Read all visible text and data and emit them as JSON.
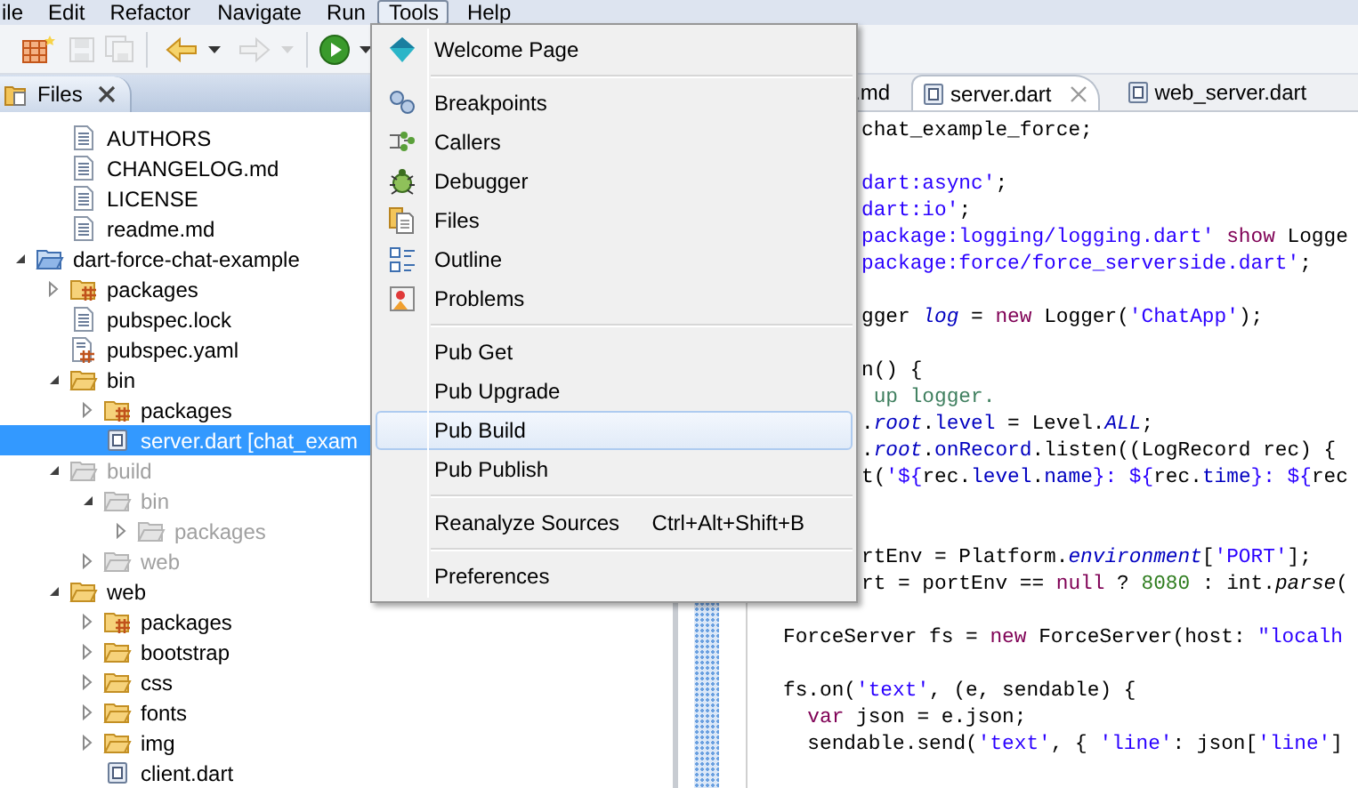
{
  "menu_bar": [
    {
      "label": "ile",
      "selected": false
    },
    {
      "label": "Edit",
      "selected": false
    },
    {
      "label": "Refactor",
      "selected": false
    },
    {
      "label": "Navigate",
      "selected": false
    },
    {
      "label": "Run",
      "selected": false
    },
    {
      "label": "Tools",
      "selected": true
    },
    {
      "label": "Help",
      "selected": false
    }
  ],
  "toolbar": [
    {
      "kind": "new",
      "disabled": false
    },
    {
      "kind": "save",
      "disabled": true
    },
    {
      "kind": "save_all",
      "disabled": true
    },
    {
      "kind": "separator"
    },
    {
      "kind": "back",
      "disabled": false
    },
    {
      "kind": "dropdown",
      "disabled": false
    },
    {
      "kind": "forward",
      "disabled": true
    },
    {
      "kind": "dropdown",
      "disabled": true
    },
    {
      "kind": "separator"
    },
    {
      "kind": "run",
      "disabled": false
    },
    {
      "kind": "dropdown",
      "disabled": false
    }
  ],
  "files_view": {
    "tab": {
      "label": "Files",
      "selected": true
    },
    "tree": {
      "continued_children": [
        {
          "label": "AUTHORS",
          "kind": "file",
          "selected": false,
          "greyed": false
        },
        {
          "label": "CHANGELOG.md",
          "kind": "file",
          "selected": false,
          "greyed": false
        },
        {
          "label": "LICENSE",
          "kind": "file",
          "selected": false,
          "greyed": false
        },
        {
          "label": "readme.md",
          "kind": "file",
          "selected": false,
          "greyed": false
        }
      ],
      "items": [
        {
          "label": "dart-force-chat-example",
          "kind": "project",
          "expanded": true,
          "selected": false,
          "greyed": false,
          "children": [
            {
              "label": "packages",
              "kind": "package_folder",
              "expanded": false,
              "selected": false,
              "greyed": false
            },
            {
              "label": "pubspec.lock",
              "kind": "file",
              "selected": false,
              "greyed": false
            },
            {
              "label": "pubspec.yaml",
              "kind": "yaml_file",
              "selected": false,
              "greyed": false
            },
            {
              "label": "bin",
              "kind": "folder",
              "expanded": true,
              "selected": false,
              "greyed": false,
              "children": [
                {
                  "label": "packages",
                  "kind": "package_folder",
                  "expanded": false,
                  "selected": false,
                  "greyed": false
                },
                {
                  "label": "server.dart [chat_exam",
                  "kind": "dart_file",
                  "selected": true,
                  "greyed": false
                }
              ]
            },
            {
              "label": "build",
              "kind": "folder",
              "expanded": true,
              "selected": false,
              "greyed": true,
              "children": [
                {
                  "label": "bin",
                  "kind": "folder",
                  "expanded": true,
                  "selected": false,
                  "greyed": true,
                  "children": [
                    {
                      "label": "packages",
                      "kind": "folder",
                      "expanded": false,
                      "selected": false,
                      "greyed": true
                    }
                  ]
                },
                {
                  "label": "web",
                  "kind": "folder",
                  "expanded": false,
                  "selected": false,
                  "greyed": true
                }
              ]
            },
            {
              "label": "web",
              "kind": "folder",
              "expanded": true,
              "selected": false,
              "greyed": false,
              "children": [
                {
                  "label": "packages",
                  "kind": "package_folder",
                  "expanded": false,
                  "selected": false,
                  "greyed": false
                },
                {
                  "label": "bootstrap",
                  "kind": "folder",
                  "expanded": false,
                  "selected": false,
                  "greyed": false
                },
                {
                  "label": "css",
                  "kind": "folder",
                  "expanded": false,
                  "selected": false,
                  "greyed": false
                },
                {
                  "label": "fonts",
                  "kind": "folder",
                  "expanded": false,
                  "selected": false,
                  "greyed": false
                },
                {
                  "label": "img",
                  "kind": "folder",
                  "expanded": false,
                  "selected": false,
                  "greyed": false
                },
                {
                  "label": "client.dart",
                  "kind": "dart_file",
                  "selected": false,
                  "greyed": false
                }
              ]
            }
          ]
        }
      ]
    }
  },
  "editor": {
    "tabs": [
      {
        "label": ".md",
        "selected": false
      },
      {
        "label": "server.dart",
        "selected": true
      },
      {
        "label": "web_server.dart",
        "selected": false
      }
    ],
    "lines": [
      {
        "kind": "behind_menu",
        "tokens": [
          {
            "text": "chat_example_force;",
            "kind": "plain"
          }
        ]
      },
      {
        "kind": "blank"
      },
      {
        "kind": "behind_menu",
        "tokens": [
          {
            "text": "dart:async'",
            "kind": "string"
          },
          {
            "text": ";",
            "kind": "plain"
          }
        ]
      },
      {
        "kind": "behind_menu",
        "tokens": [
          {
            "text": "dart:io'",
            "kind": "string"
          },
          {
            "text": ";",
            "kind": "plain"
          }
        ]
      },
      {
        "kind": "behind_menu",
        "tokens": [
          {
            "text": "package:logging/logging.dart'",
            "kind": "string"
          },
          {
            "text": " show",
            "kind": "keyword"
          },
          {
            "text": " Logge",
            "kind": "plain"
          }
        ]
      },
      {
        "kind": "behind_menu",
        "tokens": [
          {
            "text": "package:force/force_serverside.dart'",
            "kind": "string"
          },
          {
            "text": ";",
            "kind": "plain"
          }
        ]
      },
      {
        "kind": "blank"
      },
      {
        "kind": "behind_menu",
        "tokens": [
          {
            "text": "gger ",
            "kind": "plain"
          },
          {
            "text": "log",
            "kind": "static_field"
          },
          {
            "text": " = ",
            "kind": "plain"
          },
          {
            "text": "new",
            "kind": "keyword"
          },
          {
            "text": " Logger(",
            "kind": "plain"
          },
          {
            "text": "'ChatApp'",
            "kind": "string"
          },
          {
            "text": ");",
            "kind": "plain"
          }
        ]
      },
      {
        "kind": "blank"
      },
      {
        "kind": "behind_menu",
        "tokens": [
          {
            "text": "n() {",
            "kind": "plain"
          }
        ]
      },
      {
        "kind": "behind_menu",
        "tokens": [
          {
            "text": " up logger.",
            "kind": "comment"
          }
        ]
      },
      {
        "kind": "behind_menu",
        "tokens": [
          {
            "text": ".",
            "kind": "plain"
          },
          {
            "text": "root",
            "kind": "static_field"
          },
          {
            "text": ".",
            "kind": "plain"
          },
          {
            "text": "level",
            "kind": "field"
          },
          {
            "text": " = Level.",
            "kind": "plain"
          },
          {
            "text": "ALL",
            "kind": "static_field"
          },
          {
            "text": ";",
            "kind": "plain"
          }
        ]
      },
      {
        "kind": "behind_menu",
        "tokens": [
          {
            "text": ".",
            "kind": "plain"
          },
          {
            "text": "root",
            "kind": "static_field"
          },
          {
            "text": ".",
            "kind": "plain"
          },
          {
            "text": "onRecord",
            "kind": "field"
          },
          {
            "text": ".listen((LogRecord rec) {",
            "kind": "plain"
          }
        ]
      },
      {
        "kind": "behind_menu",
        "tokens": [
          {
            "text": "t(",
            "kind": "plain"
          },
          {
            "text": "'${",
            "kind": "string"
          },
          {
            "text": "rec.",
            "kind": "plain"
          },
          {
            "text": "level",
            "kind": "field"
          },
          {
            "text": ".",
            "kind": "plain"
          },
          {
            "text": "name",
            "kind": "field"
          },
          {
            "text": "}: ${",
            "kind": "string"
          },
          {
            "text": "rec.",
            "kind": "plain"
          },
          {
            "text": "time",
            "kind": "field"
          },
          {
            "text": "}: ${",
            "kind": "string"
          },
          {
            "text": "rec",
            "kind": "plain"
          }
        ]
      },
      {
        "kind": "blank"
      },
      {
        "kind": "blank"
      },
      {
        "kind": "behind_menu",
        "tokens": [
          {
            "text": "rtEnv = Platform.",
            "kind": "plain"
          },
          {
            "text": "environment",
            "kind": "static_field"
          },
          {
            "text": "[",
            "kind": "plain"
          },
          {
            "text": "'PORT'",
            "kind": "string"
          },
          {
            "text": "];",
            "kind": "plain"
          }
        ]
      },
      {
        "kind": "behind_menu",
        "tokens": [
          {
            "text": "rt = portEnv == ",
            "kind": "plain"
          },
          {
            "text": "null",
            "kind": "keyword"
          },
          {
            "text": " ? ",
            "kind": "plain"
          },
          {
            "text": "8080",
            "kind": "number"
          },
          {
            "text": " : int.",
            "kind": "plain"
          },
          {
            "text": "parse",
            "kind": "static_method"
          },
          {
            "text": "(",
            "kind": "plain"
          }
        ]
      },
      {
        "kind": "blank"
      },
      {
        "kind": "full",
        "tokens": [
          {
            "text": "ForceServer fs = ",
            "kind": "plain"
          },
          {
            "text": "new",
            "kind": "keyword"
          },
          {
            "text": " ForceServer(host: ",
            "kind": "plain"
          },
          {
            "text": "\"localh",
            "kind": "string"
          }
        ]
      },
      {
        "kind": "blank"
      },
      {
        "kind": "full",
        "tokens": [
          {
            "text": "fs.on(",
            "kind": "plain"
          },
          {
            "text": "'text'",
            "kind": "string"
          },
          {
            "text": ", (e, sendable) {",
            "kind": "plain"
          }
        ]
      },
      {
        "kind": "full",
        "tokens": [
          {
            "text": "  var",
            "kind": "keyword"
          },
          {
            "text": " json = e.json;",
            "kind": "plain"
          }
        ]
      },
      {
        "kind": "full",
        "tokens": [
          {
            "text": "  sendable.send(",
            "kind": "plain"
          },
          {
            "text": "'text'",
            "kind": "string"
          },
          {
            "text": ", { ",
            "kind": "plain"
          },
          {
            "text": "'line'",
            "kind": "string"
          },
          {
            "text": ": json[",
            "kind": "plain"
          },
          {
            "text": "'line'",
            "kind": "string"
          },
          {
            "text": "]",
            "kind": "plain"
          }
        ]
      }
    ]
  },
  "tools_menu": {
    "groups": [
      [
        {
          "label": "Welcome Page",
          "selected": false
        }
      ],
      [
        {
          "label": "Breakpoints",
          "selected": false
        },
        {
          "label": "Callers",
          "selected": false
        },
        {
          "label": "Debugger",
          "selected": false
        },
        {
          "label": "Files",
          "selected": false
        },
        {
          "label": "Outline",
          "selected": false
        },
        {
          "label": "Problems",
          "selected": false
        }
      ],
      [
        {
          "label": "Pub Get",
          "selected": false
        },
        {
          "label": "Pub Upgrade",
          "selected": false
        },
        {
          "label": "Pub Build",
          "selected": true
        },
        {
          "label": "Pub Publish",
          "selected": false
        }
      ],
      [
        {
          "label": "Reanalyze Sources",
          "shortcut": "Ctrl+Alt+Shift+B",
          "selected": false
        }
      ],
      [
        {
          "label": "Preferences",
          "selected": false
        }
      ]
    ]
  }
}
